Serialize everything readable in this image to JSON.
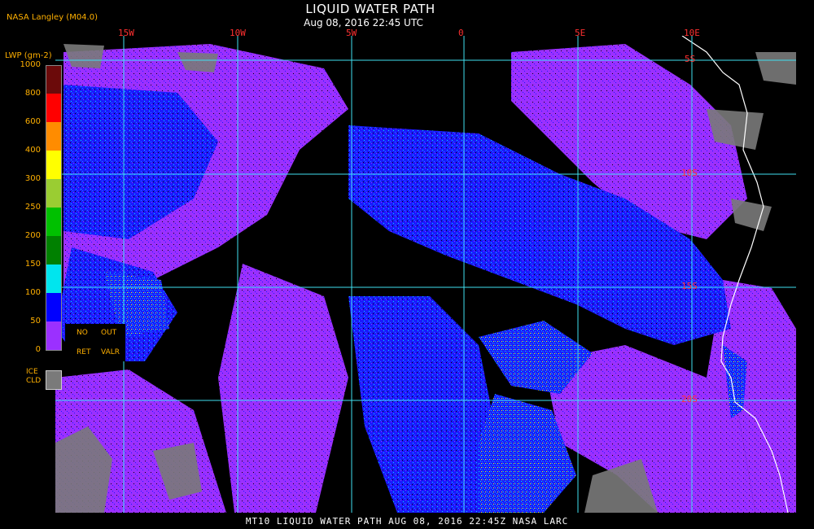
{
  "header": {
    "producer": "NASA Langley (M04.0)",
    "title": "LIQUID WATER PATH",
    "datetime": "Aug 08, 2016 22:45 UTC"
  },
  "map": {
    "longitude_labels": [
      "15W",
      "10W",
      "5W",
      "0",
      "5E",
      "10E"
    ],
    "latitude_labels": [
      "5S",
      "10S",
      "15S",
      "20S"
    ],
    "colors": {
      "gridline": "#40e0f0",
      "coastline": "#ffffff",
      "grid_label": "#ff3030",
      "background": "#000000"
    }
  },
  "legend": {
    "unit_label": "LWP (gm-2)",
    "ticks": [
      "1000",
      "800",
      "600",
      "400",
      "300",
      "250",
      "200",
      "150",
      "100",
      "50",
      "0"
    ],
    "colors": [
      "#6b0a0a",
      "#ff0000",
      "#ff8c00",
      "#ffff00",
      "#9acd32",
      "#00c000",
      "#008000",
      "#00e5ee",
      "#1e90ff",
      "#0000ff",
      "#9b30ff"
    ],
    "no_retrieval": {
      "line1": "NO",
      "line2": "RET"
    },
    "out_of_range": {
      "line1": "OUT",
      "line2": "VALR"
    },
    "ice_cloud": {
      "line1": "ICE",
      "line2": "CLD",
      "color": "#7a7a7a"
    }
  },
  "footer": {
    "caption": "MT10  LIQUID WATER PATH   AUG 08, 2016 22:45Z   NASA LARC"
  }
}
